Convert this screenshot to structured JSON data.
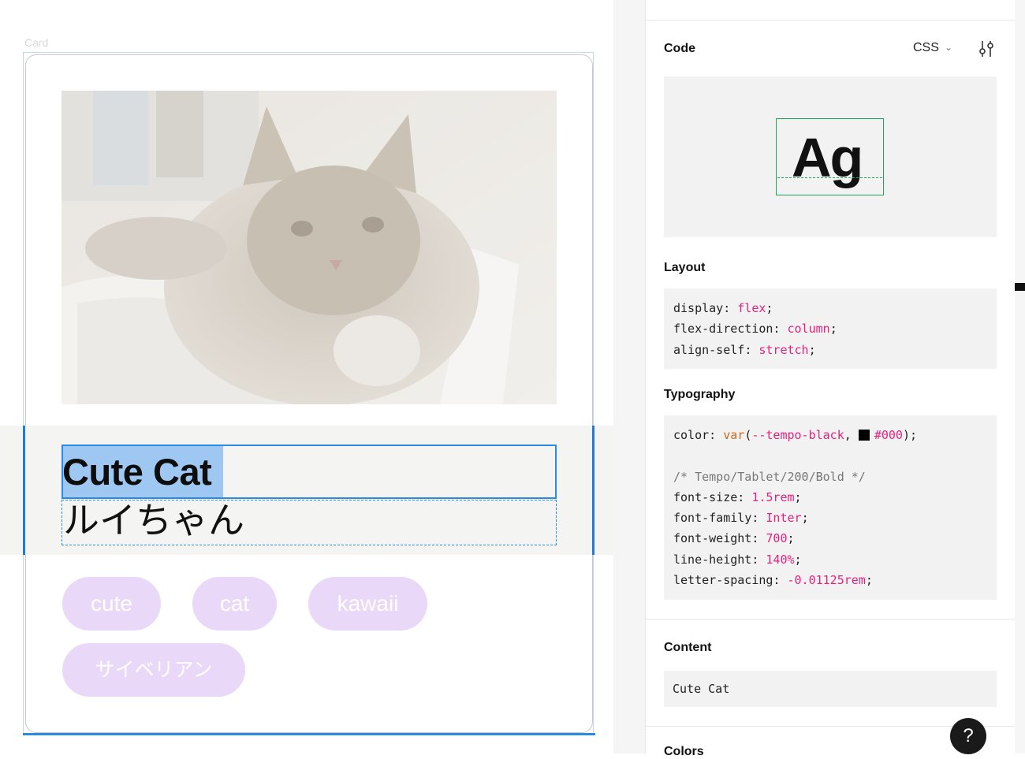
{
  "canvas": {
    "frame_label": "Card",
    "card": {
      "title": "Cute Cat",
      "subtitle": "ルイちゃん",
      "tags": [
        "cute",
        "cat",
        "kawaii",
        "サイベリアン"
      ]
    }
  },
  "inspector": {
    "code": {
      "title": "Code",
      "language": "CSS",
      "preview_text": "Ag"
    },
    "layout": {
      "title": "Layout",
      "lines": [
        {
          "prop": "display",
          "value": "flex"
        },
        {
          "prop": "flex-direction",
          "value": "column"
        },
        {
          "prop": "align-self",
          "value": "stretch"
        }
      ]
    },
    "typography": {
      "title": "Typography",
      "color_prop": "color",
      "color_fn": "var",
      "color_var": "--tempo-black",
      "color_hex": "#000",
      "comment": "/* Tempo/Tablet/200/Bold */",
      "lines": [
        {
          "prop": "font-size",
          "value": "1.5rem"
        },
        {
          "prop": "font-family",
          "value": "Inter"
        },
        {
          "prop": "font-weight",
          "value": "700"
        },
        {
          "prop": "line-height",
          "value": "140%"
        },
        {
          "prop": "letter-spacing",
          "value": "-0.01125rem"
        }
      ]
    },
    "content": {
      "title": "Content",
      "value": "Cute Cat"
    },
    "colors": {
      "title": "Colors"
    },
    "help_label": "?"
  },
  "colors": {
    "selection_blue": "#2b8ae6",
    "tag_bg": "#ead8f8",
    "code_value_pink": "#e0247e",
    "code_fn_orange": "#c96a1d",
    "preview_green": "#23a45c"
  }
}
